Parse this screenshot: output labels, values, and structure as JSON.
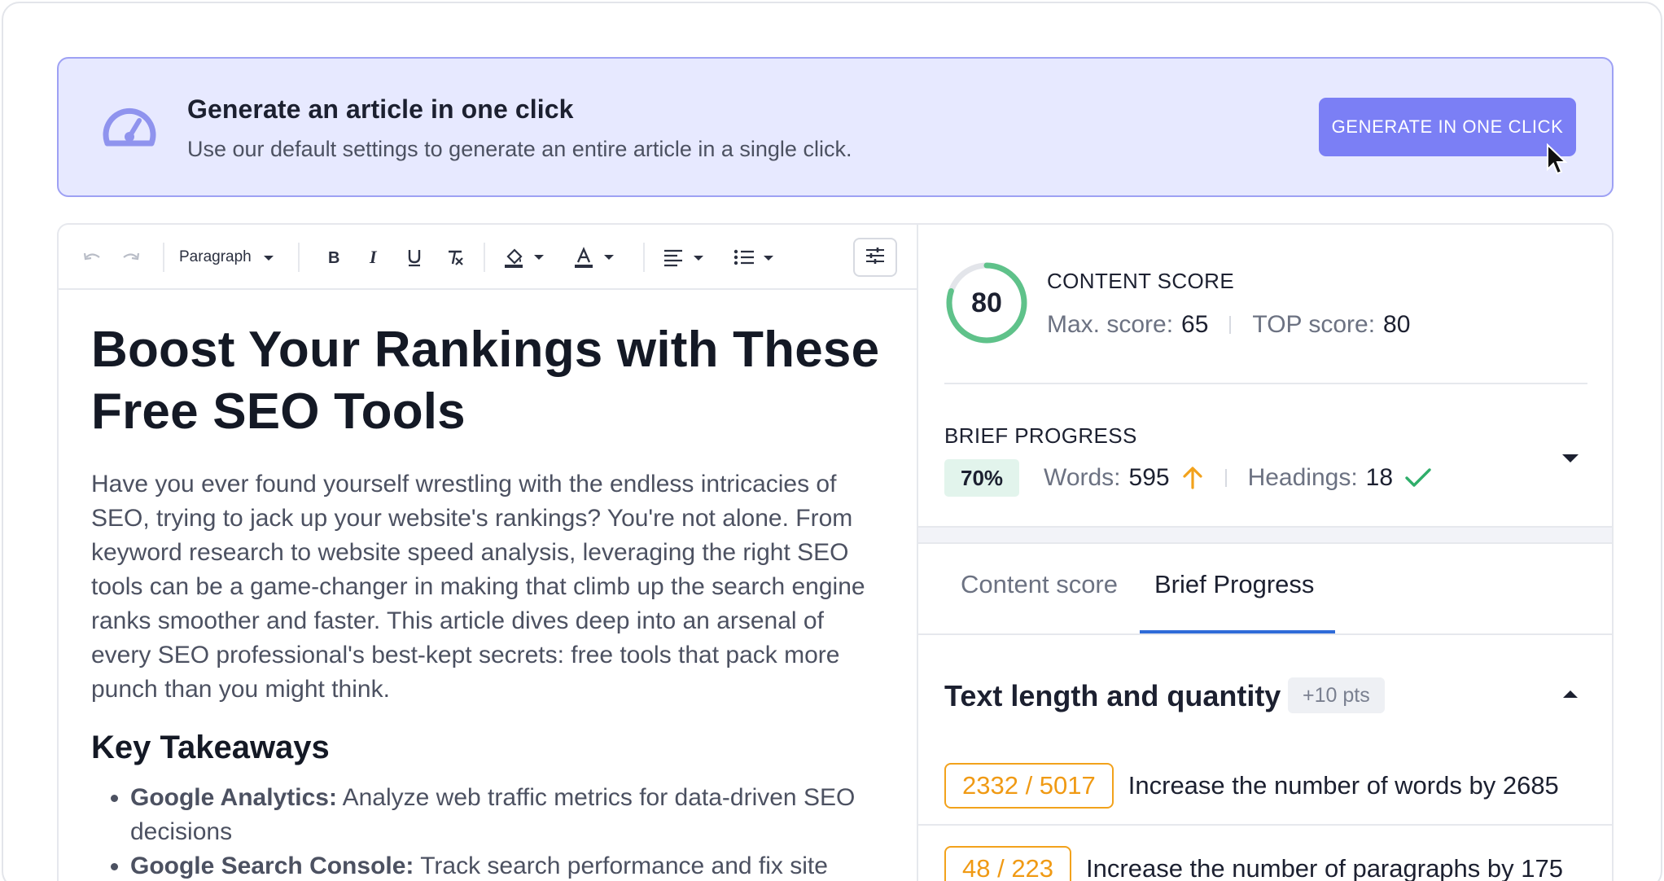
{
  "banner": {
    "icon": "speedometer-icon",
    "title": "Generate an article in one click",
    "subtitle": "Use our default settings to generate an entire article in a single click.",
    "button_label": "GENERATE IN ONE CLICK"
  },
  "toolbar": {
    "undo_icon": "undo-icon",
    "redo_icon": "redo-icon",
    "paragraph_label": "Paragraph",
    "bold_icon": "bold-icon",
    "italic_icon": "italic-icon",
    "underline_icon": "underline-icon",
    "clear_format_icon": "clear-format-icon",
    "highlight_icon": "highlight-color-icon",
    "text_color_icon": "text-color-icon",
    "align_icon": "align-left-icon",
    "list_icon": "bulleted-list-icon",
    "settings_icon": "sliders-icon"
  },
  "article": {
    "title": "Boost Your Rankings with These Free SEO Tools",
    "intro": "Have you ever found yourself wrestling with the endless intricacies of SEO, trying to jack up your website's rankings? You're not alone. From keyword research to website speed analysis, leveraging the right SEO tools can be a game-changer in making that climb up the search engine ranks smoother and faster. This article dives deep into an arsenal of every SEO professional's best-kept secrets: free tools that pack more punch than you might think.",
    "subheading": "Key Takeaways",
    "takeaways": [
      {
        "name": "Google Analytics:",
        "text": " Analyze web traffic metrics for data-driven SEO decisions"
      },
      {
        "name": "Google Search Console:",
        "text": " Track search performance and fix site"
      }
    ]
  },
  "content_score": {
    "score": "80",
    "score_fraction": 0.8,
    "label": "CONTENT SCORE",
    "max_label": "Max. score:",
    "max_value": "65",
    "top_label": "TOP score:",
    "top_value": "80",
    "ring_color": "#5fc28a"
  },
  "brief_progress": {
    "label": "BRIEF PROGRESS",
    "percent": "70%",
    "words_label": "Words:",
    "words_value": "595",
    "words_icon": "arrow-up-icon",
    "headings_label": "Headings:",
    "headings_value": "18",
    "headings_icon": "check-icon"
  },
  "tabs": [
    {
      "label": "Content score",
      "active": false
    },
    {
      "label": "Brief Progress",
      "active": true
    }
  ],
  "section": {
    "title": "Text length and quantity",
    "points": "+10 pts",
    "metrics": [
      {
        "count": "2332 / 5017",
        "text": "Increase the number of words by 2685"
      },
      {
        "count": "48 / 223",
        "text": "Increase the number of paragraphs by 175"
      }
    ]
  },
  "colors": {
    "accent": "#7b7ff5",
    "banner_bg": "#e7e9ff",
    "warning": "#f2a21c",
    "success": "#2fae6a",
    "tab_active": "#2f6bd8"
  }
}
